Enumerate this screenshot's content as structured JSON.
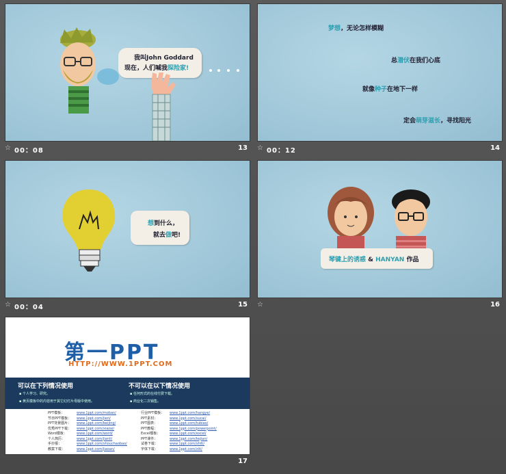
{
  "slides": [
    {
      "number": "13",
      "time": "00：08",
      "lines": {
        "l1": "我叫John Goddard",
        "l2a": "现在，人们喊我",
        "l2b": "探险家!"
      }
    },
    {
      "number": "14",
      "time": "00：12",
      "lines": {
        "a1": "梦想",
        "a2": "，无论怎样模糊",
        "b1": "总",
        "b2": "潜伏",
        "b3": "在我们心底",
        "c1": "就像",
        "c2": "种子",
        "c3": "在地下一样",
        "d1": "定会",
        "d2": "萌芽滋长",
        "d3": "，寻找阳光"
      }
    },
    {
      "number": "15",
      "time": "00：04",
      "lines": {
        "a1": "想",
        "a2": "到什么，",
        "b1": "就去",
        "b2": "做",
        "b3": "吧!"
      }
    },
    {
      "number": "16",
      "time": "",
      "lines": {
        "a1": "琴键上的诱惑",
        "a2": " & ",
        "a3": "HANYAN",
        "a4": " 作品"
      }
    },
    {
      "number": "17",
      "time": ""
    }
  ],
  "ppt_info": {
    "logo_text": "第一PPT",
    "url": "HTTP://WWW.1PPT.COM",
    "can_use_title": "可以在下列情况使用",
    "can_use_items": [
      "个人学习、研究。",
      "黄页模板中的内容用于其它幻灯片母版中使用。"
    ],
    "cannot_use_title": "不可以在以下情况使用",
    "cannot_use_items": [
      "任何形式的在线付费下载。",
      "商业化二次销售。"
    ],
    "links_left": [
      {
        "label": "PPT模板：",
        "url": "www.1ppt.com/moban/"
      },
      {
        "label": "节日PPT模板：",
        "url": "www.1ppt.com/jieri/"
      },
      {
        "label": "PPT背景图片：",
        "url": "www.1ppt.com/beijing/"
      },
      {
        "label": "优秀PPT下载：",
        "url": "www.1ppt.com/xiazai/"
      },
      {
        "label": "Word模板：",
        "url": "www.1ppt.com/word/"
      },
      {
        "label": "个人简历：",
        "url": "www.1ppt.com/jianli/"
      },
      {
        "label": "手抄报：",
        "url": "www.1ppt.com/shouchaobao/"
      },
      {
        "label": "教案下载：",
        "url": "www.1ppt.com/jiaoan/"
      }
    ],
    "links_right": [
      {
        "label": "行业PPT模板：",
        "url": "www.1ppt.com/hangye/"
      },
      {
        "label": "PPT素材：",
        "url": "www.1ppt.com/sucai/"
      },
      {
        "label": "PPT图表：",
        "url": "www.1ppt.com/tubiao/"
      },
      {
        "label": "PPT教程：",
        "url": "www.1ppt.com/powerpoint/"
      },
      {
        "label": "Excel模板：",
        "url": "www.1ppt.com/excel/"
      },
      {
        "label": "PPT课件：",
        "url": "www.1ppt.com/kejian/"
      },
      {
        "label": "试卷下载：",
        "url": "www.1ppt.com/shiti/"
      },
      {
        "label": "字体下载：",
        "url": "www.1ppt.com/ziti/"
      }
    ]
  },
  "colors": {
    "accent": "#2a9fb0",
    "banner": "#1c3a5e",
    "logo_blue": "#1f5fa8"
  }
}
